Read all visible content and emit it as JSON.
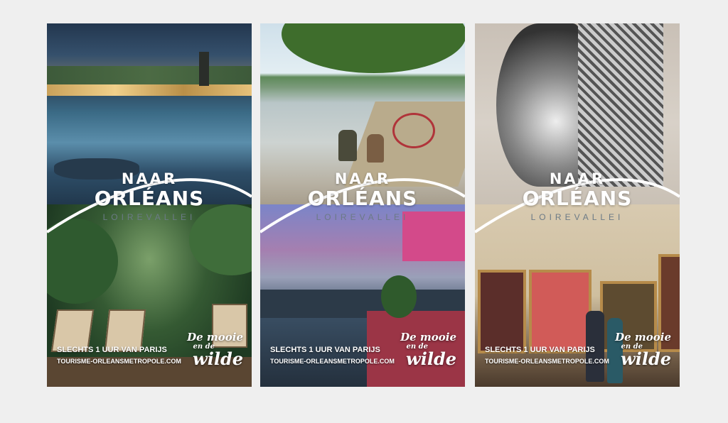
{
  "posters": [
    {
      "title_line1": "NAAR",
      "title_line2": "ORLÉANS",
      "subtitle": "LOIREVALLEI",
      "tagline": "SLECHTS 1 UUR VAN PARIJS",
      "website": "TOURISME-ORLEANSMETROPOLE.COM",
      "slogan_line1": "De mooie",
      "slogan_line2": "en de",
      "slogan_line3": "wilde"
    },
    {
      "title_line1": "NAAR",
      "title_line2": "ORLÉANS",
      "subtitle": "LOIREVALLEI",
      "tagline": "SLECHTS 1 UUR VAN PARIJS",
      "website": "TOURISME-ORLEANSMETROPOLE.COM",
      "slogan_line1": "De mooie",
      "slogan_line2": "en de",
      "slogan_line3": "wilde"
    },
    {
      "title_line1": "NAAR",
      "title_line2": "ORLÉANS",
      "subtitle": "LOIREVALLEI",
      "tagline": "SLECHTS 1 UUR VAN PARIJS",
      "website": "TOURISME-ORLEANSMETROPOLE.COM",
      "slogan_line1": "De mooie",
      "slogan_line2": "en de",
      "slogan_line3": "wilde"
    }
  ],
  "colors": {
    "page_background": "#efefef",
    "title_text": "#ffffff",
    "subtitle_text": "#6b7a86"
  }
}
